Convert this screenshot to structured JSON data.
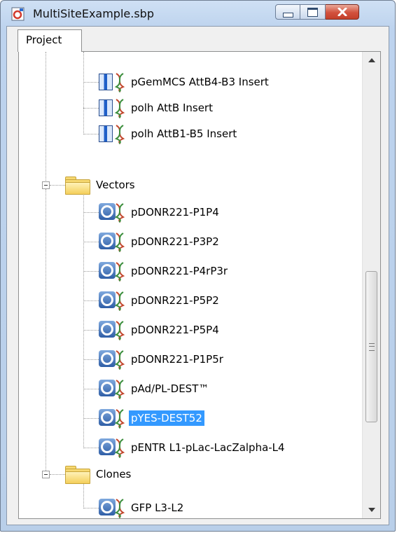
{
  "window": {
    "title": "MultiSiteExample.sbp",
    "controls": {
      "minimize": "minimize",
      "maximize": "maximize",
      "close": "close"
    }
  },
  "tabs": [
    {
      "label": "Project",
      "active": true
    }
  ],
  "tree": {
    "inserts": [
      {
        "label": "pGemMCS AttB4-B3 Insert",
        "icon": "insert-dna-icon"
      },
      {
        "label": "polh AttB Insert",
        "icon": "insert-dna-icon"
      },
      {
        "label": "polh AttB1-B5 Insert",
        "icon": "insert-dna-icon"
      }
    ],
    "vectors_folder": {
      "label": "Vectors",
      "expanded": true
    },
    "vectors": [
      {
        "label": "pDONR221-P1P4"
      },
      {
        "label": "pDONR221-P3P2"
      },
      {
        "label": "pDONR221-P4rP3r"
      },
      {
        "label": "pDONR221-P5P2"
      },
      {
        "label": "pDONR221-P5P4"
      },
      {
        "label": "pDONR221-P1P5r"
      },
      {
        "label": "pAd/PL-DEST™"
      },
      {
        "label": "pYES-DEST52",
        "selected": true
      },
      {
        "label": "pENTR L1-pLac-LacZalpha-L4"
      }
    ],
    "clones_folder": {
      "label": "Clones",
      "expanded": true
    },
    "clones": [
      {
        "label": "GFP L3-L2"
      }
    ]
  },
  "scrollbar": {
    "position_fraction": 0.72,
    "visible_fraction": 0.35
  },
  "colors": {
    "selection": "#3399ff",
    "folder": "#f6d871",
    "close_button": "#c4402a"
  }
}
